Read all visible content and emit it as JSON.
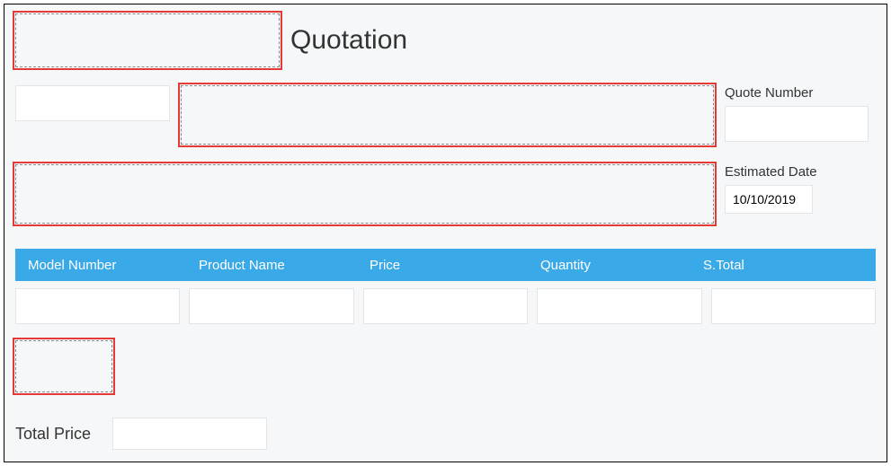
{
  "header": {
    "title": "Quotation"
  },
  "fields": {
    "quote_number_label": "Quote Number",
    "quote_number_value": "",
    "estimated_date_label": "Estimated Date",
    "estimated_date_value": "10/10/2019",
    "small_input_value": ""
  },
  "table": {
    "columns": [
      "Model Number",
      "Product Name",
      "Price",
      "Quantity",
      "S.Total"
    ],
    "row": {
      "model_number": "",
      "product_name": "",
      "price": "",
      "quantity": "",
      "subtotal": ""
    }
  },
  "total": {
    "label": "Total Price",
    "value": ""
  }
}
